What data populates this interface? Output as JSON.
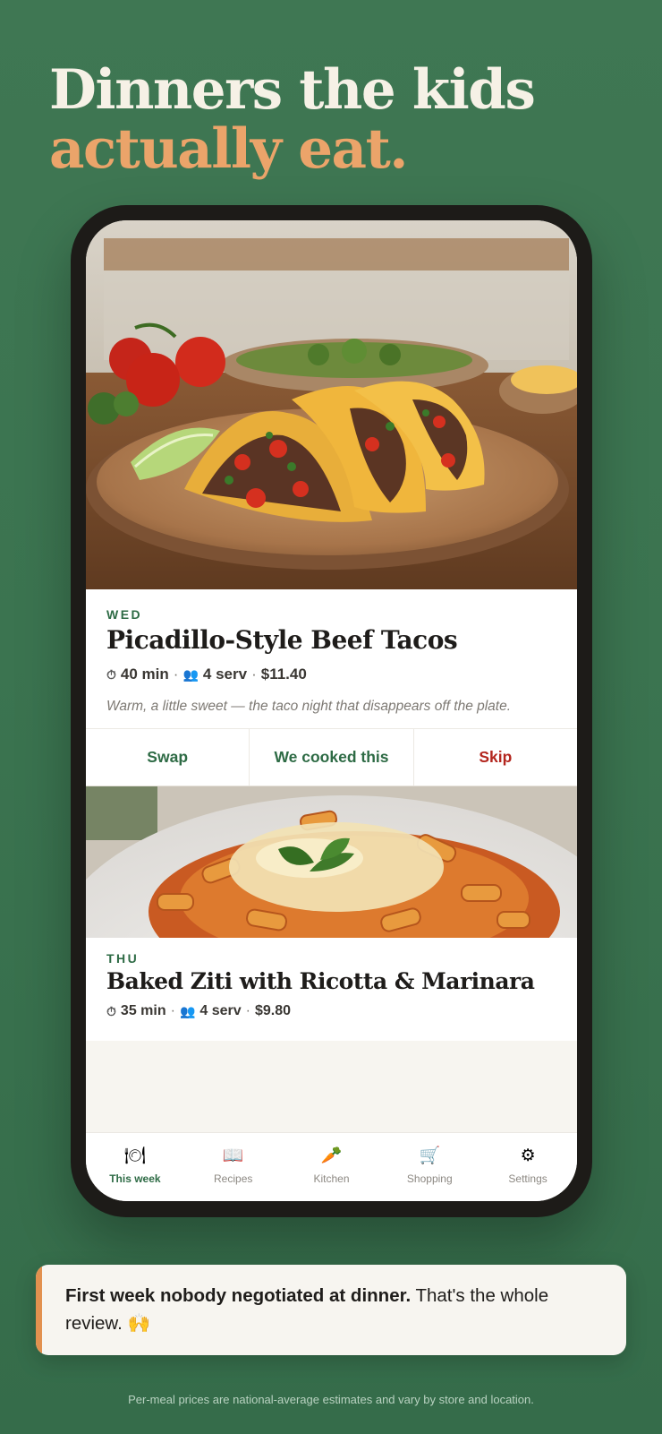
{
  "headline": {
    "line1": "Dinners the kids",
    "line2": "actually eat."
  },
  "colors": {
    "background": "#3f7753",
    "accent_orange": "#eba46a",
    "brand_green": "#2e6b45",
    "skip_red": "#b3261e"
  },
  "meals": [
    {
      "day": "WED",
      "title": "Picadillo-Style Beef Tacos",
      "time": "40 min",
      "servings": "4 serv",
      "price": "$11.40",
      "description": "Warm, a little sweet — the taco night that disappears off the plate.",
      "actions": {
        "swap": "Swap",
        "cooked": "We cooked this",
        "skip": "Skip"
      }
    },
    {
      "day": "THU",
      "title": "Baked Ziti with Ricotta & Marinara",
      "time": "35 min",
      "servings": "4 serv",
      "price": "$9.80"
    }
  ],
  "meta_separator": "·",
  "icons": {
    "time": "stopwatch-icon",
    "servings": "people-icon"
  },
  "tabs": [
    {
      "label": "This week",
      "icon": "plate-icon",
      "glyph": "🍽",
      "active": true
    },
    {
      "label": "Recipes",
      "icon": "book-icon",
      "glyph": "📖",
      "active": false
    },
    {
      "label": "Kitchen",
      "icon": "carrot-icon",
      "glyph": "🥕",
      "active": false
    },
    {
      "label": "Shopping",
      "icon": "cart-icon",
      "glyph": "🛒",
      "active": false
    },
    {
      "label": "Settings",
      "icon": "gear-icon",
      "glyph": "⚙",
      "active": false
    }
  ],
  "review": {
    "bold": "First week nobody negotiated at dinner.",
    "rest": " That's the whole review. 🙌"
  },
  "footnote": "Per-meal prices are national-average estimates and vary by store and location."
}
